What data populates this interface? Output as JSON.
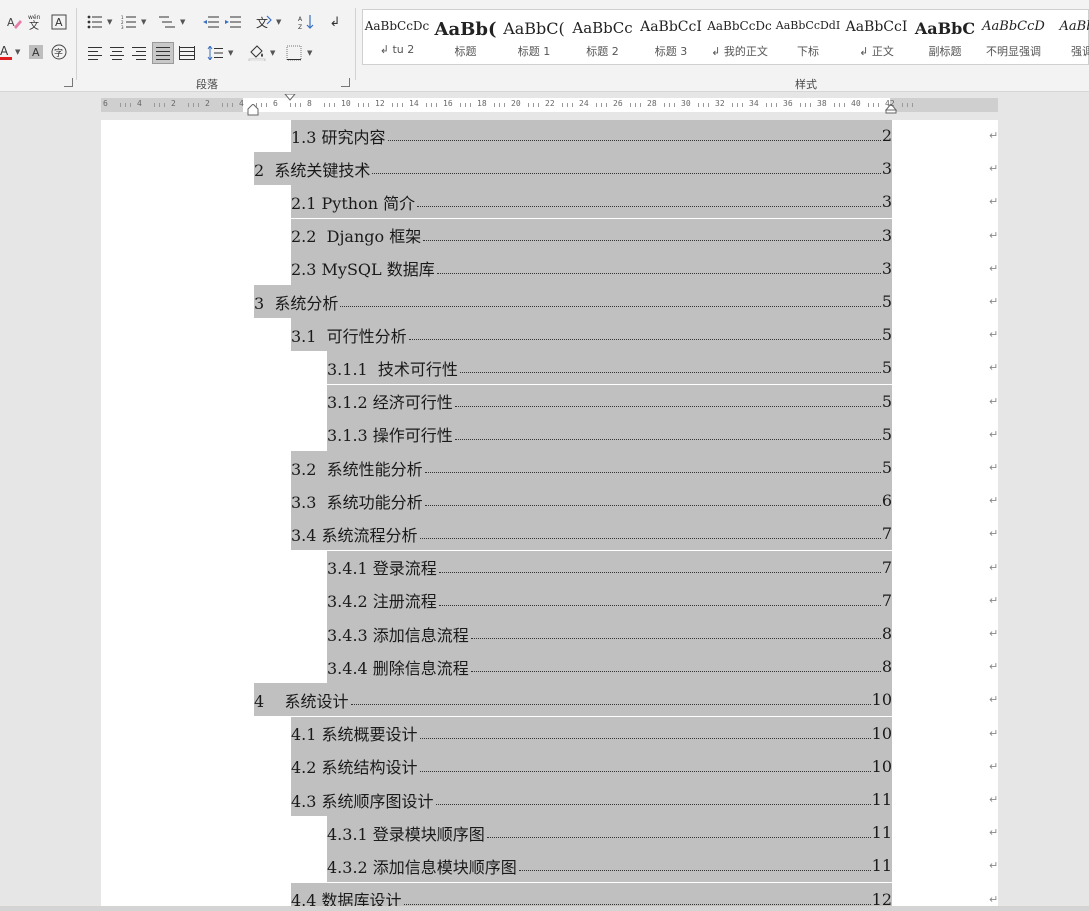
{
  "ribbon": {
    "paragraph_label": "段落",
    "styles_label": "样式",
    "styles": [
      {
        "sample": "AaBbCcDc",
        "name": "↲ tu 2",
        "size": 12,
        "bold": false,
        "italic": false
      },
      {
        "sample": "AaBb(",
        "name": "标题",
        "size": 18,
        "bold": true,
        "italic": false
      },
      {
        "sample": "AaBbC(",
        "name": "标题 1",
        "size": 16,
        "bold": false,
        "italic": false
      },
      {
        "sample": "AaBbCc",
        "name": "标题 2",
        "size": 15,
        "bold": false,
        "italic": false
      },
      {
        "sample": "AaBbCcI",
        "name": "标题 3",
        "size": 14,
        "bold": false,
        "italic": false
      },
      {
        "sample": "AaBbCcDc",
        "name": "↲ 我的正文",
        "size": 12,
        "bold": false,
        "italic": false
      },
      {
        "sample": "AaBbCcDdI",
        "name": "下标",
        "size": 11,
        "bold": false,
        "italic": false
      },
      {
        "sample": "AaBbCcI",
        "name": "↲ 正文",
        "size": 14,
        "bold": false,
        "italic": false
      },
      {
        "sample": "AaBbC",
        "name": "副标题",
        "size": 16,
        "bold": true,
        "italic": false
      },
      {
        "sample": "AaBbCcD",
        "name": "不明显强调",
        "size": 13,
        "bold": false,
        "italic": true
      },
      {
        "sample": "AaBbC",
        "name": "强调",
        "size": 13,
        "bold": false,
        "italic": true
      }
    ]
  },
  "ruler": {
    "ticks": [
      "6",
      "4",
      "2",
      "2",
      "4",
      "6",
      "8",
      "10",
      "12",
      "14",
      "16",
      "18",
      "20",
      "22",
      "24",
      "26",
      "28",
      "30",
      "32",
      "34",
      "36",
      "38",
      "40",
      "42"
    ]
  },
  "toc": [
    {
      "title": "1.3 研究内容",
      "page": "2",
      "level": 2
    },
    {
      "title": "2  系统关键技术",
      "page": "3",
      "level": 1
    },
    {
      "title": "2.1 Python 简介",
      "page": "3",
      "level": 2
    },
    {
      "title": "2.2  Django 框架",
      "page": "3",
      "level": 2
    },
    {
      "title": "2.3 MySQL 数据库",
      "page": "3",
      "level": 2
    },
    {
      "title": "3  系统分析",
      "page": "5",
      "level": 1
    },
    {
      "title": "3.1  可行性分析",
      "page": "5",
      "level": 2
    },
    {
      "title": "3.1.1  技术可行性",
      "page": "5",
      "level": 3
    },
    {
      "title": "3.1.2 经济可行性",
      "page": "5",
      "level": 3
    },
    {
      "title": "3.1.3 操作可行性",
      "page": "5",
      "level": 3
    },
    {
      "title": "3.2  系统性能分析",
      "page": "5",
      "level": 2
    },
    {
      "title": "3.3  系统功能分析",
      "page": "6",
      "level": 2
    },
    {
      "title": "3.4 系统流程分析",
      "page": "7",
      "level": 2
    },
    {
      "title": "3.4.1 登录流程",
      "page": "7",
      "level": 3
    },
    {
      "title": "3.4.2 注册流程",
      "page": "7",
      "level": 3
    },
    {
      "title": "3.4.3 添加信息流程",
      "page": "8",
      "level": 3
    },
    {
      "title": "3.4.4 删除信息流程",
      "page": "8",
      "level": 3
    },
    {
      "title": "4    系统设计",
      "page": "10",
      "level": 1
    },
    {
      "title": "4.1 系统概要设计",
      "page": "10",
      "level": 2
    },
    {
      "title": "4.2 系统结构设计",
      "page": "10",
      "level": 2
    },
    {
      "title": "4.3 系统顺序图设计",
      "page": "11",
      "level": 2
    },
    {
      "title": "4.3.1 登录模块顺序图",
      "page": "11",
      "level": 3
    },
    {
      "title": "4.3.2 添加信息模块顺序图",
      "page": "11",
      "level": 3
    },
    {
      "title": "4.4 数据库设计",
      "page": "12",
      "level": 2
    }
  ],
  "colors": {
    "highlight": "#c0c0c0",
    "font_red": "#e02020"
  }
}
